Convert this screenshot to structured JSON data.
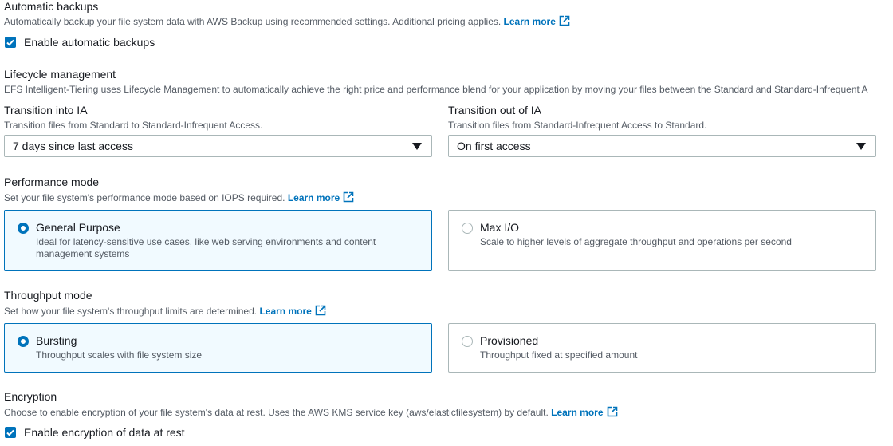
{
  "automatic_backups": {
    "title": "Automatic backups",
    "description": "Automatically backup your file system data with AWS Backup using recommended settings. Additional pricing applies.",
    "learn_more": "Learn more",
    "checkbox_label": "Enable automatic backups",
    "checked": true
  },
  "lifecycle": {
    "title": "Lifecycle management",
    "description": "EFS Intelligent-Tiering uses Lifecycle Management to automatically achieve the right price and performance blend for your application by moving your files between the Standard and Standard-Infrequent A",
    "transition_into": {
      "title": "Transition into IA",
      "description": "Transition files from Standard to Standard-Infrequent Access.",
      "value": "7 days since last access"
    },
    "transition_out": {
      "title": "Transition out of IA",
      "description": "Transition files from Standard-Infrequent Access to Standard.",
      "value": "On first access"
    }
  },
  "performance": {
    "title": "Performance mode",
    "description": "Set your file system's performance mode based on IOPS required.",
    "learn_more": "Learn more",
    "options": [
      {
        "title": "General Purpose",
        "description": "Ideal for latency-sensitive use cases, like web serving environments and content management systems",
        "selected": true
      },
      {
        "title": "Max I/O",
        "description": "Scale to higher levels of aggregate throughput and operations per second",
        "selected": false
      }
    ]
  },
  "throughput": {
    "title": "Throughput mode",
    "description": "Set how your file system's throughput limits are determined.",
    "learn_more": "Learn more",
    "options": [
      {
        "title": "Bursting",
        "description": "Throughput scales with file system size",
        "selected": true
      },
      {
        "title": "Provisioned",
        "description": "Throughput fixed at specified amount",
        "selected": false
      }
    ]
  },
  "encryption": {
    "title": "Encryption",
    "description": "Choose to enable encryption of your file system's data at rest. Uses the AWS KMS service key (aws/elasticfilesystem) by default.",
    "learn_more": "Learn more",
    "checkbox_label": "Enable encryption of data at rest",
    "checked": true
  },
  "colors": {
    "accent": "#0073bb",
    "text": "#16191f",
    "secondary_text": "#545b64",
    "border": "#aab7b8",
    "selected_tile_bg": "#f1faff"
  },
  "icons": {
    "external_link": "external-link-icon",
    "checkmark": "checkmark-icon",
    "dropdown": "caret-down-icon"
  }
}
